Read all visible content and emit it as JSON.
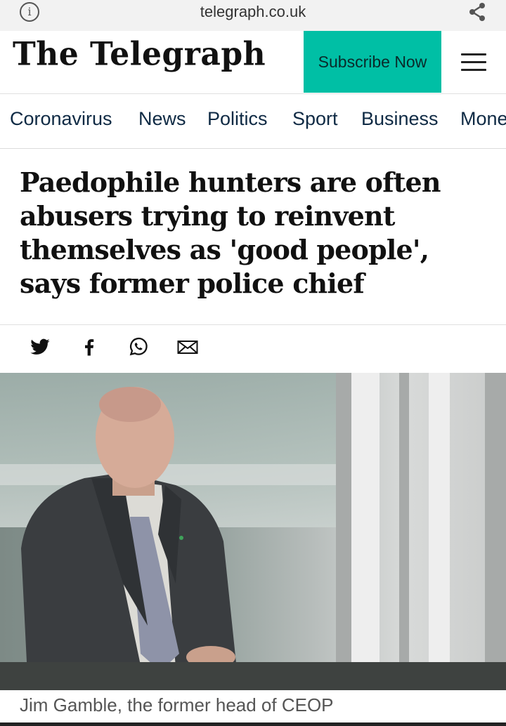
{
  "browser": {
    "url": "telegraph.co.uk",
    "info_icon": "info-icon",
    "share_icon": "share-icon"
  },
  "masthead": {
    "logo_text": "The Telegraph",
    "subscribe_label": "Subscribe Now",
    "subscribe_color": "#00bfa5",
    "menu_icon": "hamburger-menu-icon"
  },
  "nav": {
    "items": [
      "Coronavirus",
      "News",
      "Politics",
      "Sport",
      "Business",
      "Mone"
    ]
  },
  "article": {
    "headline": "Paedophile hunters are often abusers trying to reinvent themselves as 'good people', says former police chief",
    "share_icons": [
      "twitter-icon",
      "facebook-icon",
      "whatsapp-icon",
      "email-icon"
    ],
    "image_caption": "Jim Gamble, the former head of CEOP"
  }
}
